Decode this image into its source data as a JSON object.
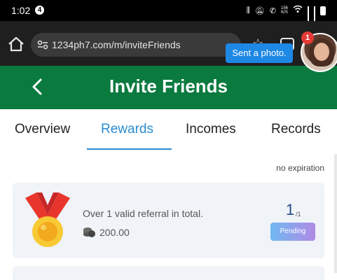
{
  "status_bar": {
    "time": "1:02",
    "notification_count": "4",
    "network_speed_top": "156",
    "network_speed_unit": "K/S"
  },
  "browser": {
    "url": "1234ph7.com/m/inviteFriends",
    "tab_count": ""
  },
  "header": {
    "title": "Invite Friends"
  },
  "tabs": [
    {
      "label": "Overview"
    },
    {
      "label": "Rewards"
    },
    {
      "label": "Incomes"
    },
    {
      "label": "Records"
    }
  ],
  "active_tab": "Rewards",
  "rewards": {
    "expiry_label": "no expiration",
    "items": [
      {
        "description": "Over 1 valid referral in total.",
        "amount": "200.00",
        "progress_current": "1",
        "progress_total": "/1",
        "status": "Pending"
      }
    ]
  },
  "chat_overlay": {
    "message": "Sent a photo.",
    "badge_count": "1"
  },
  "colors": {
    "header_green": "#0a7a3f",
    "active_tab_blue": "#2a8bd0",
    "pending_gradient_start": "#6fb8f0",
    "pending_gradient_end": "#b18ae6"
  }
}
